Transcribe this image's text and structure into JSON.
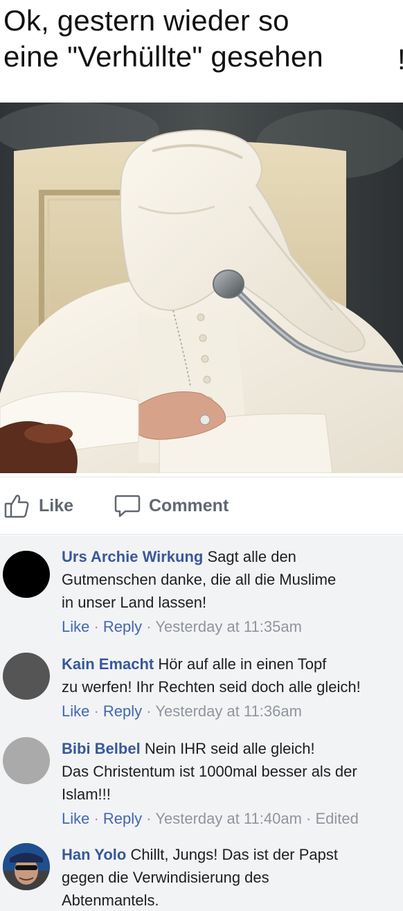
{
  "caption": {
    "line1": "Ok, gestern wieder so",
    "line2": "eine \"Verhüllte\" gesehen",
    "edge_mark": "!"
  },
  "actions": {
    "like_label": "Like",
    "comment_label": "Comment"
  },
  "comments": [
    {
      "author": "Urs Archie Wirkung",
      "lines": [
        "Sagt alle den",
        "Gutmenschen danke, die all die Muslime",
        "in unser Land lassen!"
      ],
      "like": "Like",
      "reply": "Reply",
      "time": "Yesterday at 11:35am",
      "edited": "",
      "avatar_color": "#000000"
    },
    {
      "author": "Kain Emacht",
      "lines": [
        "Hör auf alle in einen Topf",
        "zu werfen! Ihr Rechten seid doch alle gleich!"
      ],
      "like": "Like",
      "reply": "Reply",
      "time": "Yesterday at 11:36am",
      "edited": "",
      "avatar_color": "#555555"
    },
    {
      "author": "Bibi Belbel",
      "lines": [
        "Nein IHR seid alle gleich!",
        "Das Christentum ist 1000mal besser als der",
        "Islam!!!"
      ],
      "like": "Like",
      "reply": "Reply",
      "time": "Yesterday at 11:40am",
      "edited": "Edited",
      "avatar_color": "#aaaaaa"
    },
    {
      "author": "Han Yolo",
      "lines": [
        "Chillt, Jungs! Das ist der Papst",
        "gegen die Verwindisierung des",
        "Abtenmantels."
      ],
      "like": "",
      "reply": "",
      "time": "",
      "edited": "",
      "avatar_color": "#2a5a9a"
    }
  ],
  "colors": {
    "author_link": "#385898",
    "meta_link": "#4267b2",
    "meta_text": "#90949c",
    "comments_bg": "#f2f3f5"
  },
  "icons": {
    "like": "thumbs-up-outline-icon",
    "comment": "speech-bubble-outline-icon"
  }
}
